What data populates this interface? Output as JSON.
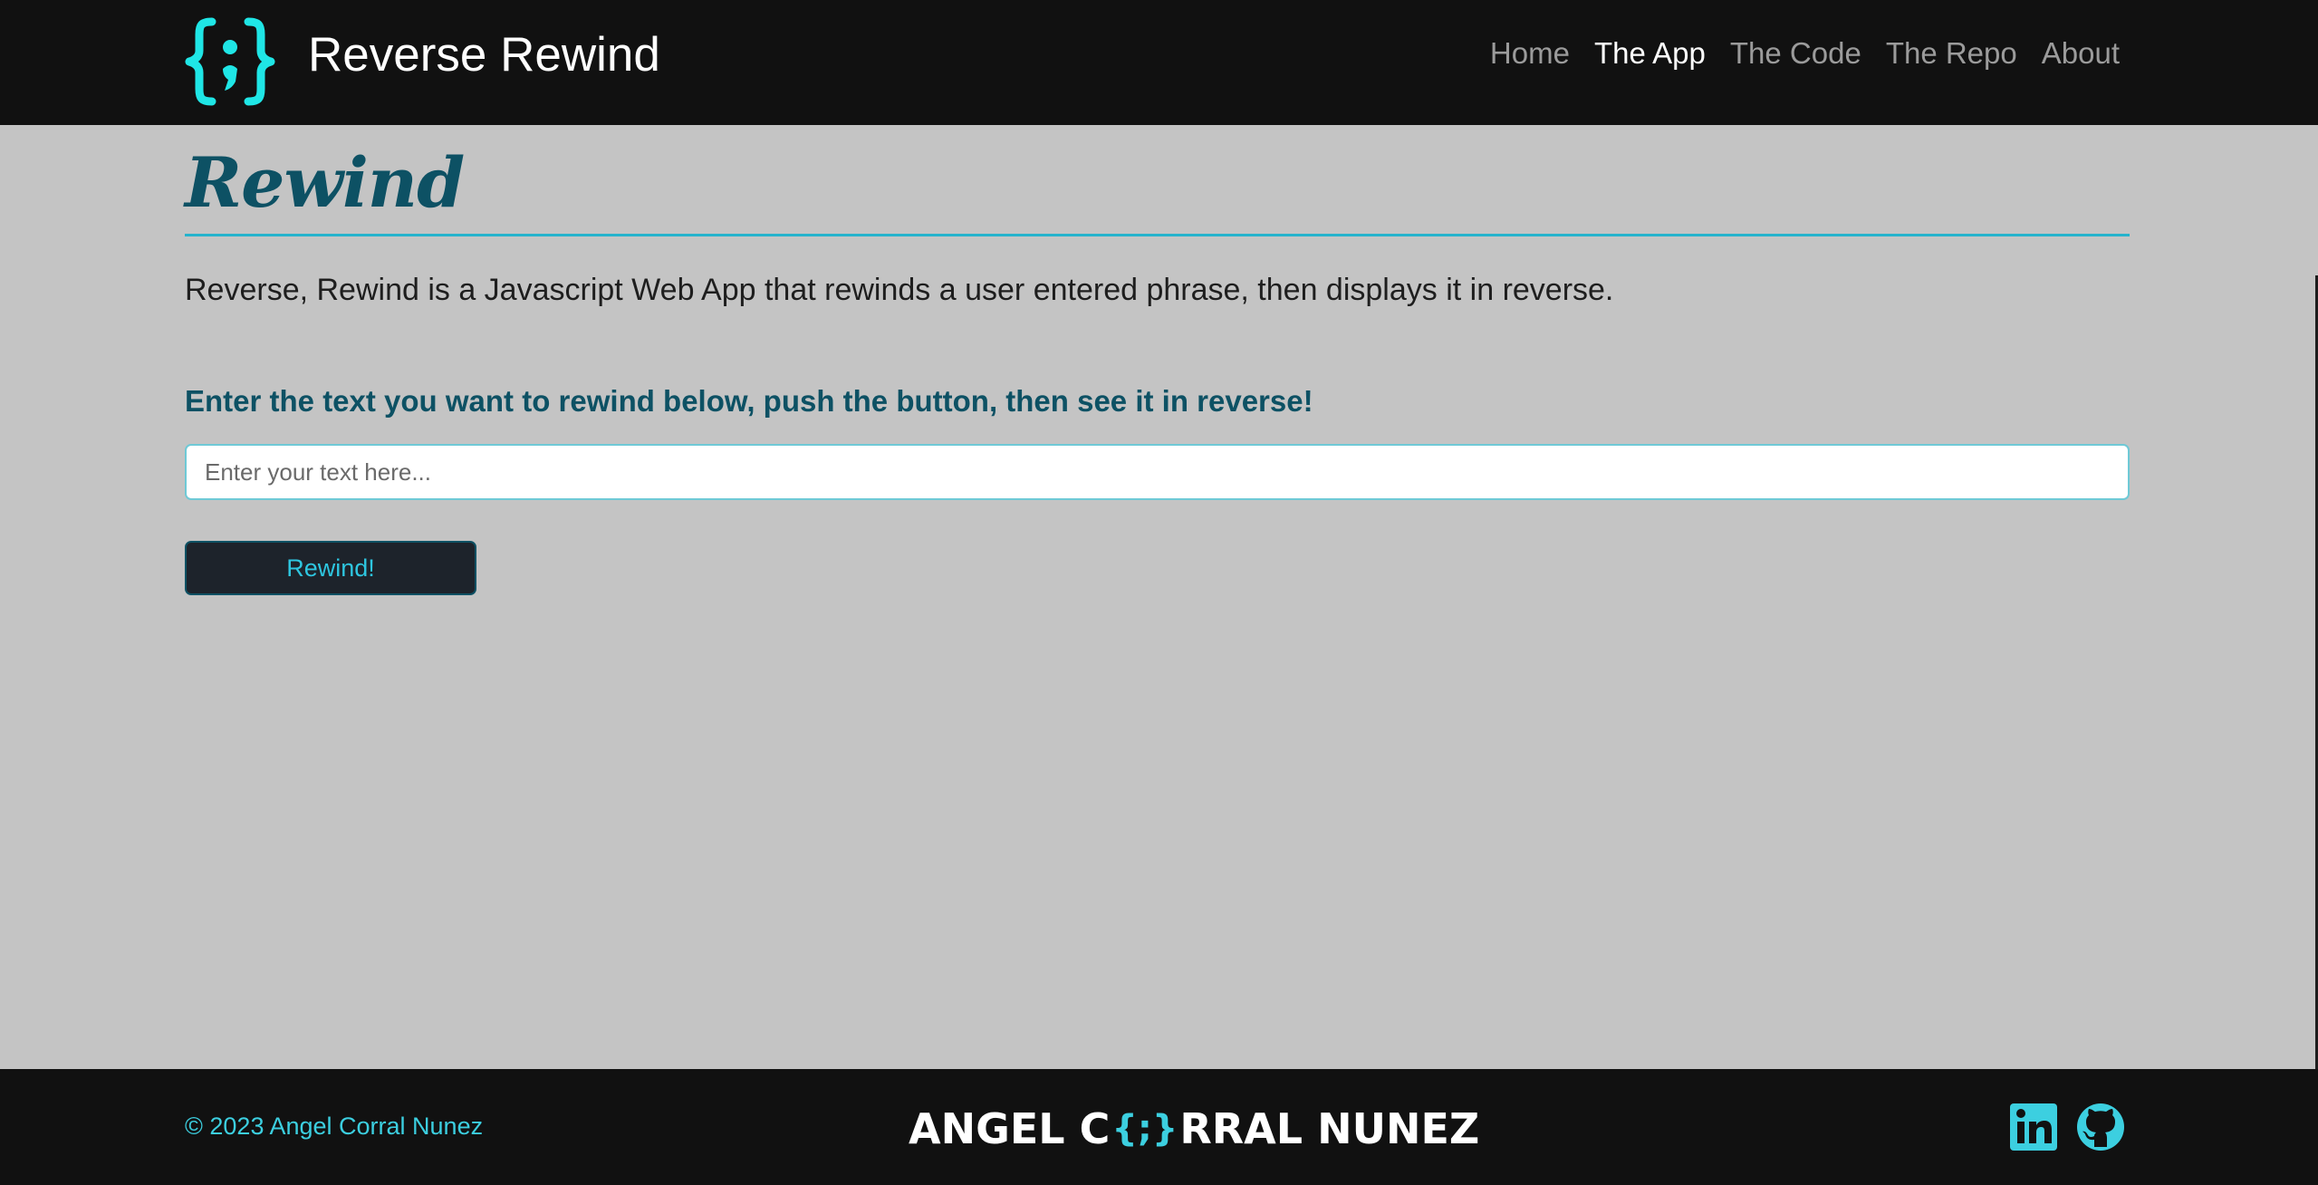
{
  "brand": {
    "name": "Reverse Rewind",
    "logo_icon": "curly-braces-semicolon-icon",
    "accent_color": "#1fe6e6"
  },
  "nav": {
    "items": [
      {
        "label": "Home",
        "active": false
      },
      {
        "label": "The App",
        "active": true
      },
      {
        "label": "The Code",
        "active": false
      },
      {
        "label": "The Repo",
        "active": false
      },
      {
        "label": "About",
        "active": false
      }
    ]
  },
  "main": {
    "title": "Rewind",
    "description": "Reverse, Rewind is a Javascript Web App that rewinds a user entered phrase, then displays it in reverse.",
    "instructions": "Enter the text you want to rewind below, push the button, then see it in reverse!",
    "input": {
      "value": "",
      "placeholder": "Enter your text here..."
    },
    "button_label": "Rewind!"
  },
  "footer": {
    "copyright": "© 2023 Angel Corral Nunez",
    "logo_left": "ANGEL C",
    "logo_glyph": "{;}",
    "logo_right": "RRAL NUNEZ",
    "social": [
      {
        "name": "linkedin-icon",
        "color": "#3ccfe0"
      },
      {
        "name": "github-icon",
        "color": "#3ccfe0"
      }
    ]
  },
  "colors": {
    "navbar_bg": "#111111",
    "page_bg": "#c4c4c4",
    "heading": "#0d5164",
    "accent": "#25b3cc"
  }
}
